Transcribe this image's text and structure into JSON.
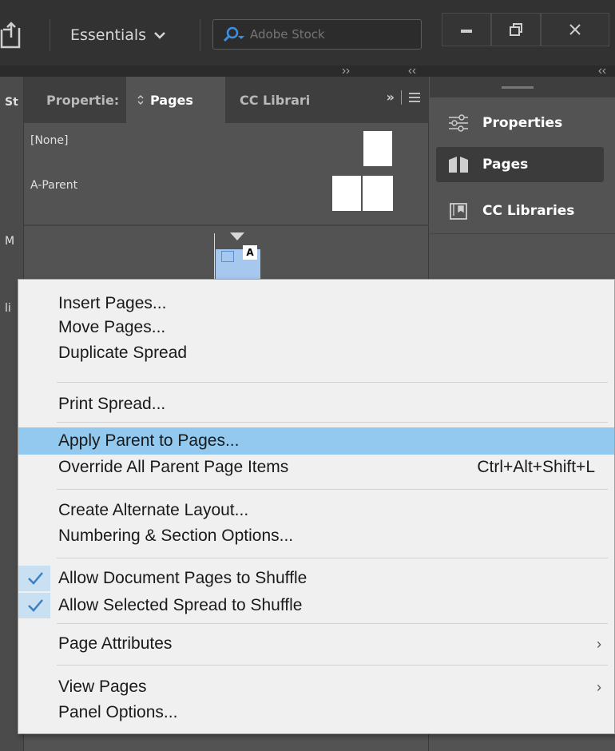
{
  "titlebar": {
    "workspace_label": "Essentials",
    "search_placeholder": "Adobe Stock"
  },
  "left_strip": {
    "labels": [
      "St",
      "M",
      "li"
    ]
  },
  "pages_panel": {
    "tabs": [
      "Propertie:",
      "Pages",
      "CC Librari"
    ],
    "tab_overflow": "»",
    "parents": [
      "[None]",
      "A-Parent"
    ],
    "spread_label": "A"
  },
  "right_strip": {
    "items": [
      {
        "label": "Properties",
        "icon": "sliders-icon"
      },
      {
        "label": "Pages",
        "icon": "pages-icon"
      },
      {
        "label": "CC Libraries",
        "icon": "libraries-icon"
      }
    ]
  },
  "context_menu": {
    "items": [
      {
        "label": "Insert Pages..."
      },
      {
        "label": "Move Pages..."
      },
      {
        "label": "Duplicate Spread"
      },
      {
        "label": "Print Spread..."
      },
      {
        "label": "Apply Parent to Pages..."
      },
      {
        "label": "Override All Parent Page Items",
        "shortcut": "Ctrl+Alt+Shift+L"
      },
      {
        "label": "Create Alternate Layout..."
      },
      {
        "label": "Numbering & Section Options..."
      },
      {
        "label": "Allow Document Pages to Shuffle",
        "checked": true
      },
      {
        "label": "Allow Selected Spread to Shuffle",
        "checked": true
      },
      {
        "label": "Page Attributes",
        "submenu": "›"
      },
      {
        "label": "View Pages",
        "submenu": "›"
      },
      {
        "label": "Panel Options..."
      }
    ],
    "highlight_color": "#93c9ee",
    "check_color": "#3b7fc4"
  }
}
